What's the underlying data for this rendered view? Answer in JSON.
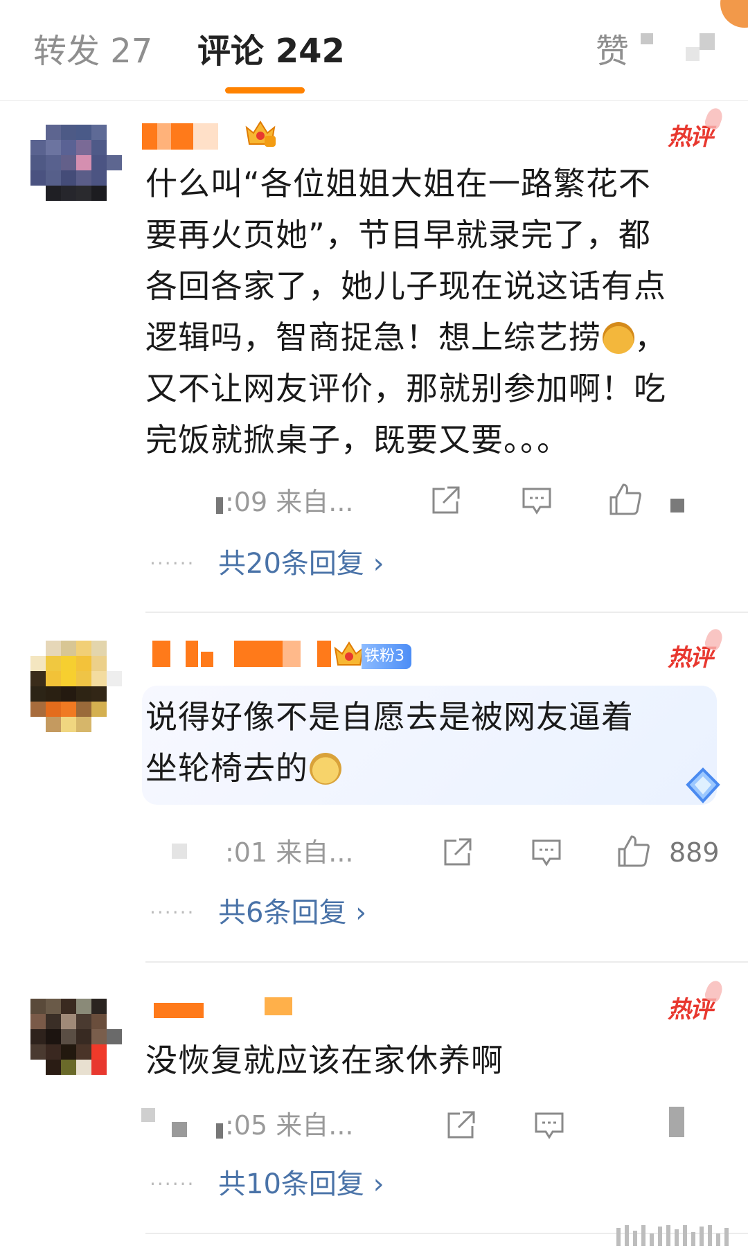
{
  "tabs": {
    "repost": "转发 27",
    "comments": "评论 242",
    "likes": "赞"
  },
  "colors": {
    "accent": "#ff8200",
    "hot": "#e8382f",
    "link": "#4a73a8"
  },
  "comments": [
    {
      "hot_label": "热评",
      "text_lines": [
        "什么叫“各位姐姐大姐在一路繁花不",
        "要再火页她”，节目早就录完了，都",
        "各回各家了，她儿子现在说这话有点",
        "逻辑吗，智商捉急！想上综艺捞",
        "又不让网友评价，那就别参加啊！吃",
        "完饭就掀桌子，既要又要。。。"
      ],
      "line4_suffix": "，",
      "emoji": "money-bag",
      "time": ":09",
      "source": "来自...",
      "replies": "共20条回复 ›"
    },
    {
      "hot_label": "热评",
      "fan_badge": "铁粉3",
      "text_lines": [
        "说得好像不是自愿去是被网友逼着",
        "坐轮椅去的"
      ],
      "emoji": "sick-face",
      "time": ":01",
      "source": "来自...",
      "likes": "889",
      "replies": "共6条回复 ›"
    },
    {
      "hot_label": "热评",
      "text_lines": [
        "没恢复就应该在家休养啊"
      ],
      "time": ":05",
      "source": "来自...",
      "replies": "共10条回复 ›"
    }
  ],
  "reply_dots": "······"
}
